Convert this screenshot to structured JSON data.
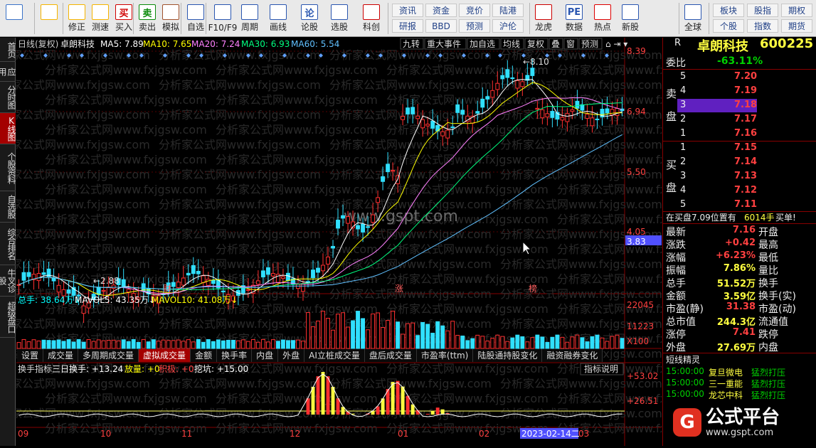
{
  "toolbar": {
    "buttons": [
      {
        "label": "",
        "icon": "grid-icon",
        "color": "#3b73c8"
      },
      {
        "label": "",
        "icon": "back-arrow-icon",
        "color": "#f5b400"
      },
      {
        "label": "修正",
        "icon": "up-down-arrows-icon",
        "color": "#f5b400"
      },
      {
        "label": "测速",
        "icon": "speedometer-icon",
        "color": "#f5b400"
      },
      {
        "label": "买入",
        "icon": "buy-icon",
        "color": "#d00000",
        "glyph": "买"
      },
      {
        "label": "卖出",
        "icon": "sell-icon",
        "color": "#0a8a0a",
        "glyph": "卖"
      },
      {
        "label": "模拟",
        "icon": "gavel-icon",
        "color": "#a0522d"
      },
      {
        "label": "自选",
        "icon": "star-list-icon",
        "color": "#2a56b0"
      },
      {
        "label": "F10/F9",
        "icon": "f10-icon",
        "color": "#2a56b0"
      },
      {
        "label": "周期",
        "icon": "period-clock-icon",
        "color": "#2a56b0"
      },
      {
        "label": "画线",
        "icon": "pencil-icon",
        "color": "#2a56b0"
      },
      {
        "label": "论股",
        "icon": "forum-icon",
        "color": "#2a56b0",
        "glyph": "论"
      },
      {
        "label": "选股",
        "icon": "stock-picker-icon",
        "color": "#2a56b0"
      },
      {
        "label": "科创",
        "icon": "star-market-icon",
        "color": "#c00"
      },
      {
        "label": "龙虎",
        "icon": "dragon-tiger-icon",
        "color": "#c00"
      },
      {
        "label": "数据",
        "icon": "pe-data-icon",
        "color": "#2a56b0",
        "glyph": "PE"
      },
      {
        "label": "热点",
        "icon": "hot-icon",
        "color": "#d00"
      },
      {
        "label": "新股",
        "icon": "new-stock-icon",
        "color": "#2a56b0"
      },
      {
        "label": "全球",
        "icon": "globe-icon",
        "color": "#2a56b0"
      }
    ],
    "small": [
      "资讯",
      "资金",
      "竞价",
      "陆港",
      "研报",
      "BBD",
      "预测",
      "沪伦",
      "板块",
      "股指",
      "期权",
      "个股",
      "指数",
      "期货"
    ]
  },
  "nav": [
    "首页",
    "应用",
    "分时图",
    "K线图",
    "个股资料",
    "自选股",
    "综合排名",
    "牛叉诊股",
    "超级盘口"
  ],
  "nav_active": 3,
  "chart_header": {
    "title": "日线(复权)",
    "stock": "卓朗科技",
    "ma5": "MA5: 7.89",
    "ma10": "MA10: 7.65",
    "ma20": "MA20: 7.24",
    "ma30": "MA30: 6.93",
    "ma60": "MA60: 5.54",
    "buttons": [
      "九转",
      "重大事件",
      "加自选",
      "均线",
      "复权",
      "叠",
      "窗",
      "预测"
    ]
  },
  "price_axis": [
    "8.39",
    "6.94",
    "5.50",
    "4.05",
    "3.83"
  ],
  "price_labels": {
    "high": "8.10",
    "low": "2.88"
  },
  "markers": [
    "财",
    "涨",
    "榜"
  ],
  "watermark": "www.gspt.com",
  "bg_watermark": "分析家公式网www.fxjgsw.com",
  "volume": {
    "title": "总手: 38.64万",
    "mavol5": "MAVOL5: 43.35万",
    "mavol10": "MAVOL10: 41.08万",
    "axis": [
      "22045",
      "11223",
      "X100"
    ]
  },
  "tabs": [
    "设置",
    "成交量",
    "多周期成交量",
    "虚拟成交量",
    "金额",
    "换手率",
    "内盘",
    "外盘",
    "AI立桩成交量",
    "盘后成交量",
    "市盈率(ttm)",
    "陆股通持股变化",
    "融资融券变化"
  ],
  "tab_active": 3,
  "indicator": {
    "title": "换手指标",
    "three_day": "三日换手: +13.24",
    "volume_up": "放量: +0",
    "active": "积极: +0",
    "dig": "挖坑: +15.00",
    "help": "指标说明",
    "axis": [
      "+53.02",
      "+26.51"
    ]
  },
  "x_axis": [
    "09",
    "10",
    "11",
    "12",
    "01",
    "02",
    "2023-02-14二",
    "03"
  ],
  "right": {
    "r": "R",
    "name": "卓朗科技",
    "code": "600225",
    "webi_label": "委比",
    "webi": "-63.11%",
    "sell": [
      [
        "5",
        "7.20"
      ],
      [
        "4",
        "7.19"
      ],
      [
        "3",
        "7.18"
      ],
      [
        "2",
        "7.17"
      ],
      [
        "1",
        "7.16"
      ]
    ],
    "buy": [
      [
        "1",
        "7.15"
      ],
      [
        "2",
        "7.14"
      ],
      [
        "3",
        "7.13"
      ],
      [
        "4",
        "7.12"
      ],
      [
        "5",
        "7.11"
      ]
    ],
    "sell_label": "卖盘",
    "buy_label": "买盘",
    "notice": "在买盘7.09位置有",
    "notice_vol": "6014手",
    "notice_act": "买单!",
    "stats": [
      [
        "最新",
        "7.16",
        "开盘"
      ],
      [
        "涨跌",
        "+0.42",
        "最高"
      ],
      [
        "涨幅",
        "+6.23%",
        "最低"
      ],
      [
        "振幅",
        "7.86%",
        "量比"
      ],
      [
        "总手",
        "51.52万",
        "换手"
      ],
      [
        "金额",
        "3.59亿",
        "换手(实)"
      ],
      [
        "市盈(静)",
        "31.38",
        "市盈(动)"
      ],
      [
        "总市值",
        "244.3亿",
        "流通值"
      ],
      [
        "涨停",
        "7.41",
        "跌停"
      ],
      [
        "外盘",
        "27.69万",
        "内盘"
      ]
    ],
    "short_title": "短线精灵",
    "short": [
      [
        "15:00:00",
        "复旦微电",
        "猛烈打压"
      ],
      [
        "15:00:00",
        "三一重能",
        "猛烈打压"
      ],
      [
        "15:00:00",
        "龙芯中科",
        "猛烈打压"
      ]
    ]
  },
  "brand": "公式平台",
  "brand_url": "www.gspt.com"
}
